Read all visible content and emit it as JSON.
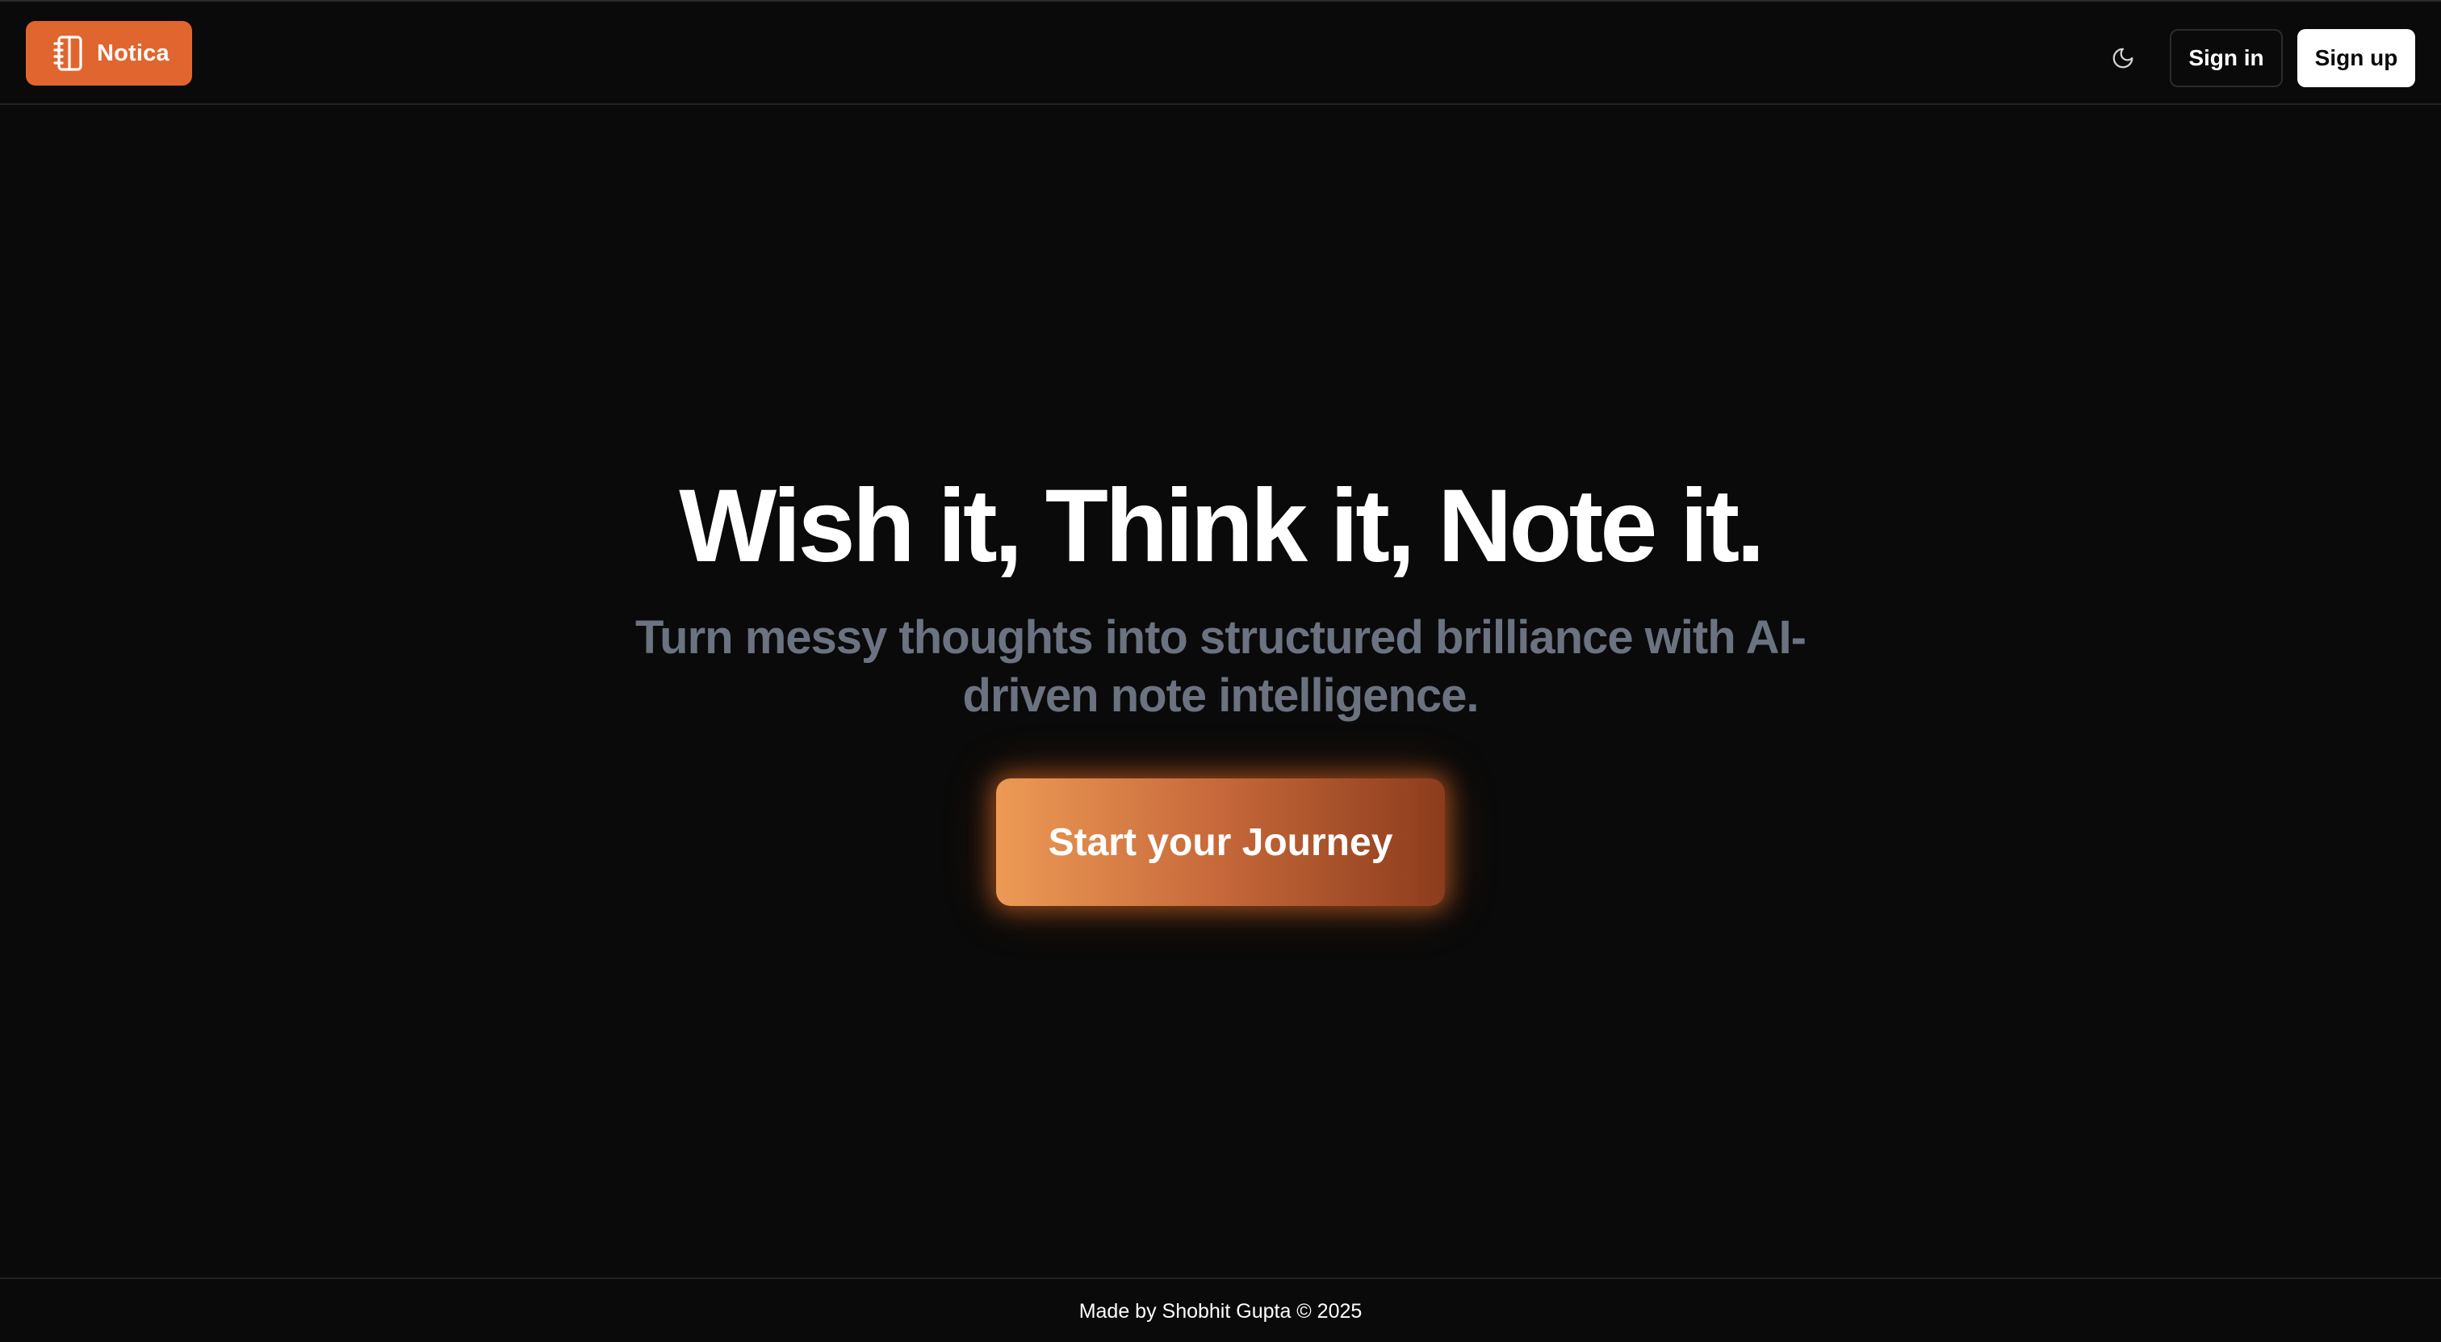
{
  "header": {
    "brand": {
      "name": "Notica",
      "icon": "notebook-icon",
      "background_color": "#e0652e"
    },
    "theme_toggle": {
      "icon": "moon-icon"
    },
    "sign_in_label": "Sign in",
    "sign_up_label": "Sign up"
  },
  "hero": {
    "title": "Wish it, Think it, Note it.",
    "subtitle_line1": "Turn messy thoughts into structured brilliance with AI-",
    "subtitle_line2": "driven note intelligence.",
    "cta_label": "Start your Journey",
    "cta_gradient": [
      "#ed9a55",
      "#c6683a",
      "#8c3c1c"
    ]
  },
  "footer": {
    "text": "Made by Shobhit Gupta © 2025"
  },
  "colors": {
    "background": "#0a0a0a",
    "accent": "#e0652e",
    "muted_text": "#6b7280"
  }
}
